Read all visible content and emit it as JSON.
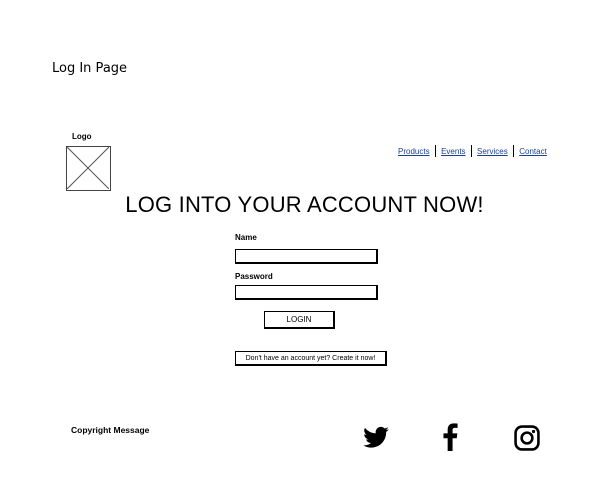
{
  "page": {
    "title": "Log In Page"
  },
  "header": {
    "logo_label": "Logo",
    "nav": [
      "Products",
      "Events",
      "Services",
      "Contact"
    ]
  },
  "main": {
    "headline": "LOG INTO YOUR ACCOUNT NOW!",
    "name_label": "Name",
    "name_value": "",
    "password_label": "Password",
    "password_value": "",
    "login_label": "LOGIN",
    "create_account_label": "Don't have an account yet? Create it now!"
  },
  "footer": {
    "copyright": "Copyright Message",
    "social_icons": [
      "twitter-icon",
      "facebook-icon",
      "instagram-icon"
    ]
  }
}
